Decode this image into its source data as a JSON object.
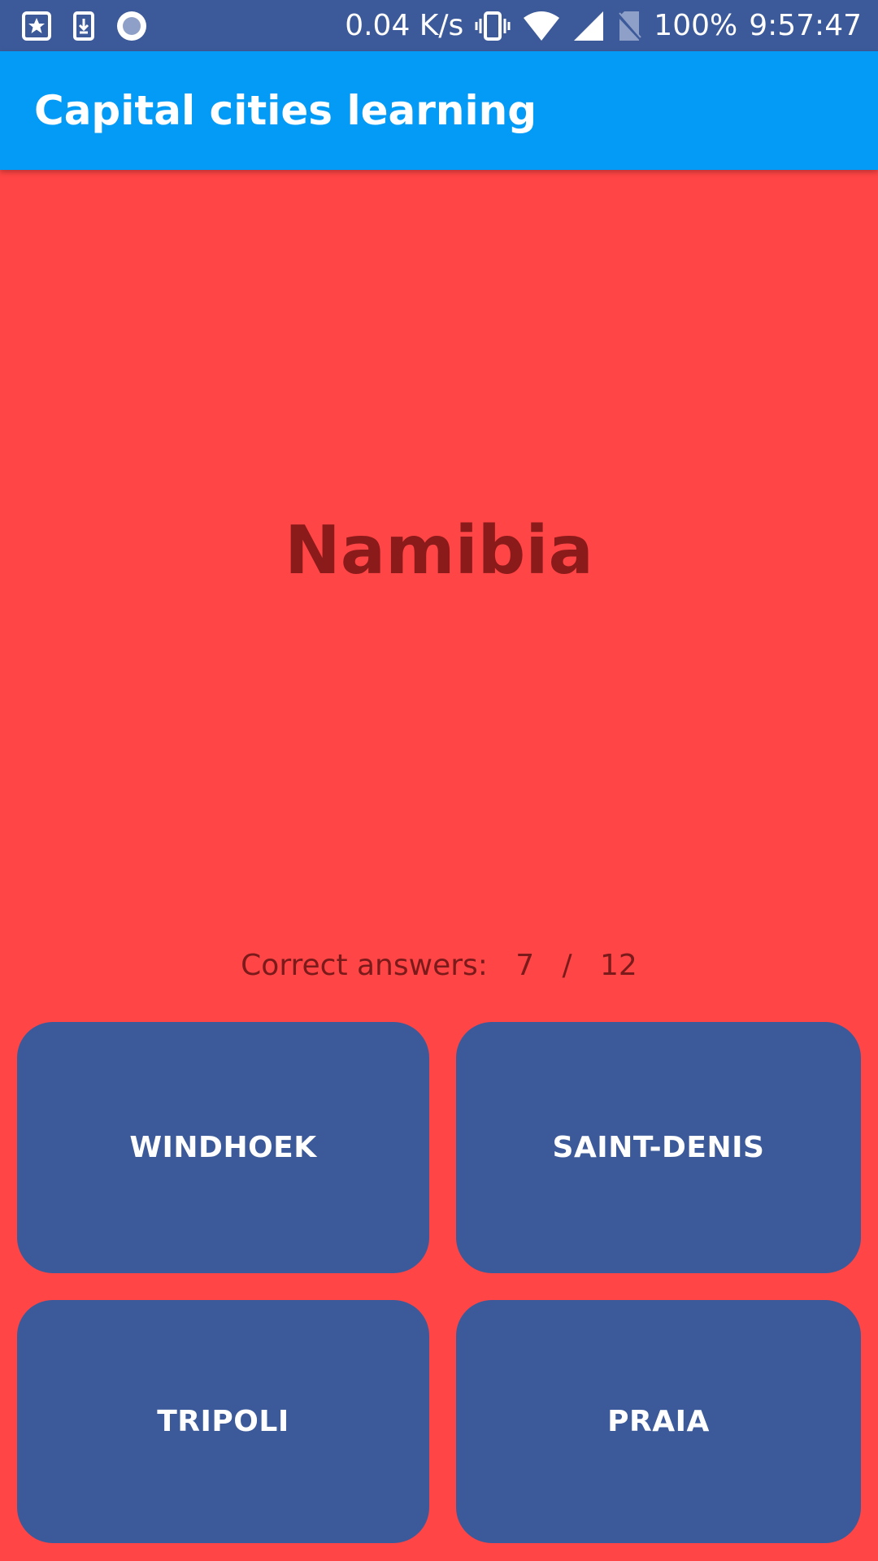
{
  "status_bar": {
    "network_speed": "0.04 K/s",
    "battery": "100%",
    "time": "9:57:47",
    "icons": [
      "bookmark-star-icon",
      "download-icon",
      "circle-dot-icon",
      "vibrate-icon",
      "wifi-icon",
      "cell-signal-icon",
      "no-sim-icon"
    ]
  },
  "app_bar": {
    "title": "Capital cities learning"
  },
  "quiz": {
    "country": "Namibia",
    "score_label": "Correct answers:",
    "score_correct": "7",
    "score_separator": "/",
    "score_total": "12",
    "answers": [
      "WINDHOEK",
      "SAINT-DENIS",
      "TRIPOLI",
      "PRAIA"
    ]
  },
  "colors": {
    "background": "#FF4545",
    "status_bar": "#3C5A99",
    "app_bar": "#039BF5",
    "button": "#3C5A99",
    "country_text": "#8B1A1A"
  }
}
